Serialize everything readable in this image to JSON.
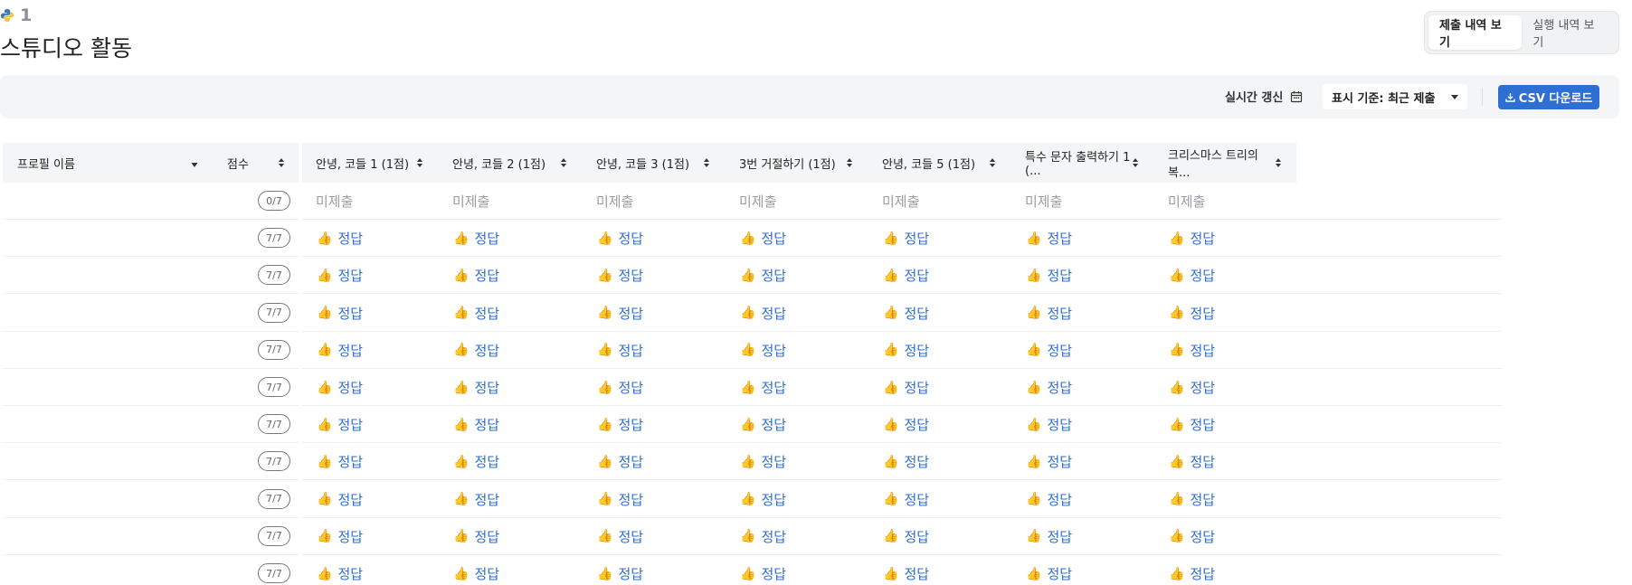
{
  "header": {
    "course_number": "1",
    "title": "스튜디오 활동"
  },
  "view_toggle": {
    "options": [
      "제출 내역 보기",
      "실행 내역 보기"
    ],
    "active_index": 0
  },
  "toolbar": {
    "realtime_label": "실시간 갱신",
    "display_select": "표시 기준: 최근 제출",
    "csv_button": "CSV 다운로드"
  },
  "table": {
    "columns": [
      "프로필 이름",
      "점수",
      "안녕, 코들 1 (1점)",
      "안녕, 코들 2 (1점)",
      "안녕, 코들 3 (1점)",
      "3번 거절하기 (1점)",
      "안녕, 코들 5 (1점)",
      "특수 문자 출력하기 1 (...",
      "크리스마스 트리의 복..."
    ],
    "rows": [
      {
        "profile": "",
        "score": "0/7",
        "results": [
          "미제출",
          "미제출",
          "미제출",
          "미제출",
          "미제출",
          "미제출",
          "미제출"
        ]
      },
      {
        "profile": "",
        "score": "7/7",
        "results": [
          "정답",
          "정답",
          "정답",
          "정답",
          "정답",
          "정답",
          "정답"
        ]
      },
      {
        "profile": "",
        "score": "7/7",
        "results": [
          "정답",
          "정답",
          "정답",
          "정답",
          "정답",
          "정답",
          "정답"
        ]
      },
      {
        "profile": "",
        "score": "7/7",
        "results": [
          "정답",
          "정답",
          "정답",
          "정답",
          "정답",
          "정답",
          "정답"
        ]
      },
      {
        "profile": "",
        "score": "7/7",
        "results": [
          "정답",
          "정답",
          "정답",
          "정답",
          "정답",
          "정답",
          "정답"
        ]
      },
      {
        "profile": "",
        "score": "7/7",
        "results": [
          "정답",
          "정답",
          "정답",
          "정답",
          "정답",
          "정답",
          "정답"
        ]
      },
      {
        "profile": "",
        "score": "7/7",
        "results": [
          "정답",
          "정답",
          "정답",
          "정답",
          "정답",
          "정답",
          "정답"
        ]
      },
      {
        "profile": "",
        "score": "7/7",
        "results": [
          "정답",
          "정답",
          "정답",
          "정답",
          "정답",
          "정답",
          "정답"
        ]
      },
      {
        "profile": "",
        "score": "7/7",
        "results": [
          "정답",
          "정답",
          "정답",
          "정답",
          "정답",
          "정답",
          "정답"
        ]
      },
      {
        "profile": "",
        "score": "7/7",
        "results": [
          "정답",
          "정답",
          "정답",
          "정답",
          "정답",
          "정답",
          "정답"
        ]
      },
      {
        "profile": "",
        "score": "7/7",
        "results": [
          "정답",
          "정답",
          "정답",
          "정답",
          "정답",
          "정답",
          "정답"
        ]
      }
    ]
  },
  "colors": {
    "accent": "#2f6fd4",
    "muted": "#9a9ea5",
    "header_bg": "#f4f5f6"
  },
  "icons": {
    "correct": "thumbs-up-icon",
    "realtime": "calendar-icon",
    "csv": "download-icon",
    "sort": "sort-icon",
    "select": "caret-down-icon",
    "brand": "python-icon"
  }
}
